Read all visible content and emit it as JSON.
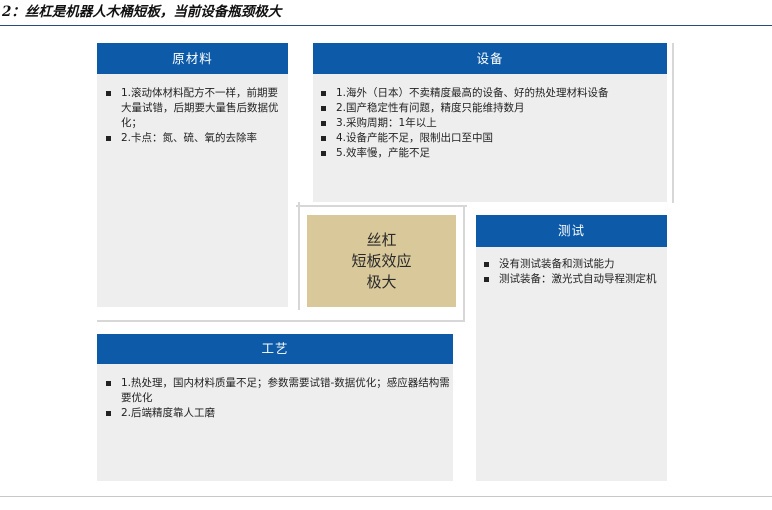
{
  "figure_title": "2：丝杠是机器人木桶短板，当前设备瓶颈极大",
  "colors": {
    "header": "#0d5ba8",
    "center": "#d8c89a",
    "panel": "#eeeeee"
  },
  "center": {
    "line1": "丝杠",
    "line2": "短板效应",
    "line3": "极大"
  },
  "panels": {
    "materials": {
      "title": "原材料",
      "items": [
        "1.滚动体材料配方不一样，前期要大量试错，后期要大量售后数据优化；",
        "2.卡点：氮、硫、氧的去除率"
      ]
    },
    "equipment": {
      "title": "设备",
      "items": [
        "1.海外（日本）不卖精度最高的设备、好的热处理材料设备",
        "2.国产稳定性有问题，精度只能维持数月",
        "3.采购周期：1年以上",
        "4.设备产能不足，限制出口至中国",
        "5.效率慢，产能不足"
      ]
    },
    "testing": {
      "title": "测试",
      "items": [
        "没有测试装备和测试能力",
        "测试装备：激光式自动导程测定机"
      ]
    },
    "process": {
      "title": "工艺",
      "items": [
        "1.热处理，国内材料质量不足；参数需要试错-数据优化；感应器结构需要优化",
        "2.后端精度靠人工磨"
      ]
    }
  }
}
